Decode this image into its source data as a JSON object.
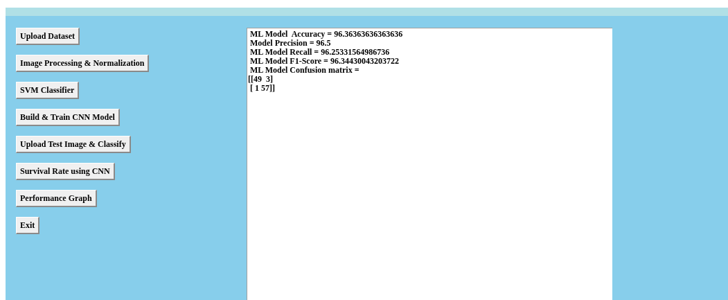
{
  "buttons": [
    "Upload Dataset",
    "Image Processing & Normalization",
    "SVM Classifier",
    "Build & Train CNN Model",
    "Upload Test Image & Classify",
    "Survival Rate using CNN",
    "Performance Graph",
    "Exit"
  ],
  "output": {
    "lines": [
      " ML Model  Accuracy = 96.36363636363636",
      " Model Precision = 96.5",
      " ML Model Recall = 96.25331564986736",
      " ML Model F1-Score = 96.34430043203722",
      " ML Model Confusion matrix =",
      "[[49  3]",
      " [ 1 57]]"
    ]
  }
}
